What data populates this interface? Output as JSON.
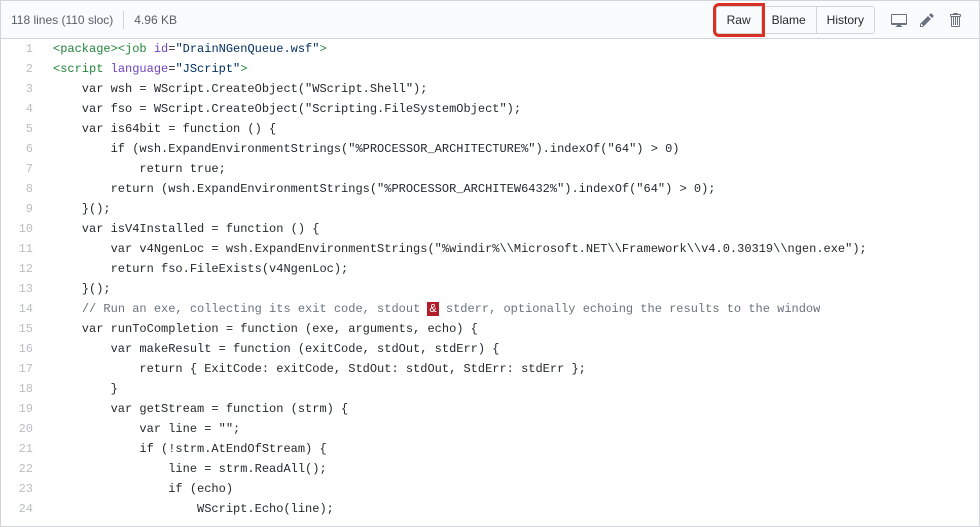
{
  "header": {
    "lines_text": "118 lines (110 sloc)",
    "size_text": "4.96 KB",
    "raw_label": "Raw",
    "blame_label": "Blame",
    "history_label": "History"
  },
  "code_lines": [
    {
      "n": 1,
      "html": "<span class=\"pl-ent\">&lt;package&gt;</span><span class=\"pl-ent\">&lt;job</span> <span class=\"pl-e\">id</span>=<span class=\"pl-s\">\"DrainNGenQueue.wsf\"</span><span class=\"pl-ent\">&gt;</span>"
    },
    {
      "n": 2,
      "html": "<span class=\"pl-ent\">&lt;script</span> <span class=\"pl-e\">language</span>=<span class=\"pl-s\">\"JScript\"</span><span class=\"pl-ent\">&gt;</span>"
    },
    {
      "n": 3,
      "html": "    var wsh = WScript.CreateObject(\"WScript.Shell\");"
    },
    {
      "n": 4,
      "html": "    var fso = WScript.CreateObject(\"Scripting.FileSystemObject\");"
    },
    {
      "n": 5,
      "html": "    var is64bit = function () {"
    },
    {
      "n": 6,
      "html": "        if (wsh.ExpandEnvironmentStrings(\"%PROCESSOR_ARCHITECTURE%\").indexOf(\"64\") &gt; 0)"
    },
    {
      "n": 7,
      "html": "            return true;"
    },
    {
      "n": 8,
      "html": "        return (wsh.ExpandEnvironmentStrings(\"%PROCESSOR_ARCHITEW6432%\").indexOf(\"64\") &gt; 0);"
    },
    {
      "n": 9,
      "html": "    }();"
    },
    {
      "n": 10,
      "html": "    var isV4Installed = function () {"
    },
    {
      "n": 11,
      "html": "        var v4NgenLoc = wsh.ExpandEnvironmentStrings(\"%windir%\\\\Microsoft.NET\\\\Framework\\\\v4.0.30319\\\\ngen.exe\");"
    },
    {
      "n": 12,
      "html": "        return fso.FileExists(v4NgenLoc);"
    },
    {
      "n": 13,
      "html": "    }();"
    },
    {
      "n": 14,
      "html": "    <span class=\"pl-c\">// Run an exe, collecting its exit code, stdout </span><span class=\"pl-red\">&amp;</span><span class=\"pl-c\"> stderr, optionally echoing the results to the window</span>"
    },
    {
      "n": 15,
      "html": "    var runToCompletion = function (exe, arguments, echo) {"
    },
    {
      "n": 16,
      "html": "        var makeResult = function (exitCode, stdOut, stdErr) {"
    },
    {
      "n": 17,
      "html": "            return { ExitCode: exitCode, StdOut: stdOut, StdErr: stdErr };"
    },
    {
      "n": 18,
      "html": "        }"
    },
    {
      "n": 19,
      "html": "        var getStream = function (strm) {"
    },
    {
      "n": 20,
      "html": "            var line = \"\";"
    },
    {
      "n": 21,
      "html": "            if (!strm.AtEndOfStream) {"
    },
    {
      "n": 22,
      "html": "                line = strm.ReadAll();"
    },
    {
      "n": 23,
      "html": "                if (echo)"
    },
    {
      "n": 24,
      "html": "                    WScript.Echo(line);"
    }
  ]
}
